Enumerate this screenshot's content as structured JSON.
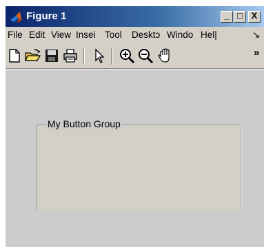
{
  "window": {
    "title": "Figure 1",
    "buttons": {
      "minimize": "_",
      "maximize": "□",
      "close": "X"
    }
  },
  "menubar": {
    "items": [
      "File",
      "Edit",
      "View",
      "Insei",
      "Tool",
      "Desktɔ",
      "Windo",
      "Hel|",
      "↘"
    ]
  },
  "toolbar": {
    "icons": [
      "new-file-icon",
      "open-folder-icon",
      "save-icon",
      "print-icon",
      "pointer-icon",
      "zoom-in-icon",
      "zoom-out-icon",
      "pan-hand-icon"
    ],
    "overflow": "»"
  },
  "panel": {
    "title": "My Button Group"
  },
  "colors": {
    "titlebar_start": "#0a246a",
    "titlebar_end": "#a6caf0",
    "chrome": "#d4d0c8",
    "figure_bg": "#cccccc"
  }
}
